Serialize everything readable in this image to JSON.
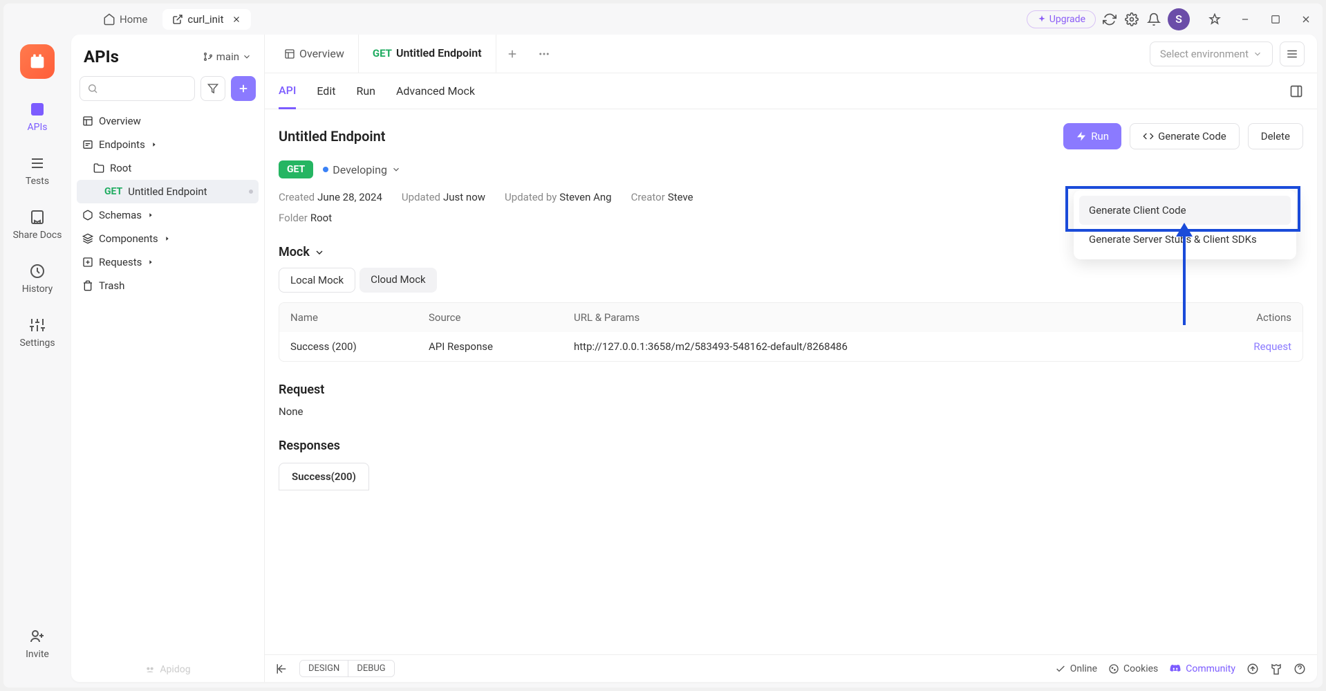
{
  "titlebar": {
    "home": "Home",
    "active_tab": "curl_init",
    "upgrade": "Upgrade",
    "avatar_letter": "S"
  },
  "rail": {
    "items": [
      "APIs",
      "Tests",
      "Share Docs",
      "History",
      "Settings",
      "Invite"
    ]
  },
  "sidebar": {
    "title": "APIs",
    "branch": "main",
    "tree": {
      "overview": "Overview",
      "endpoints": "Endpoints",
      "root": "Root",
      "endpoint_method": "GET",
      "endpoint_name": "Untitled Endpoint",
      "schemas": "Schemas",
      "components": "Components",
      "requests": "Requests",
      "trash": "Trash"
    },
    "footer": "Apidog"
  },
  "editor": {
    "tabs": {
      "overview": "Overview",
      "endpoint_method": "GET",
      "endpoint_name": "Untitled Endpoint"
    },
    "env_placeholder": "Select environment",
    "subtabs": [
      "API",
      "Edit",
      "Run",
      "Advanced Mock"
    ],
    "title": "Untitled Endpoint",
    "buttons": {
      "run": "Run",
      "generate": "Generate Code",
      "delete": "Delete"
    },
    "method": "GET",
    "status": "Developing",
    "meta": {
      "created_label": "Created",
      "created_val": "June 28, 2024",
      "updated_label": "Updated",
      "updated_val": "Just now",
      "updatedby_label": "Updated by",
      "updatedby_val": "Steven Ang",
      "creator_label": "Creator",
      "creator_val": "Steve",
      "folder_label": "Folder",
      "folder_val": "Root"
    },
    "mock": {
      "heading": "Mock",
      "local": "Local Mock",
      "cloud": "Cloud Mock",
      "cols": {
        "name": "Name",
        "source": "Source",
        "url": "URL & Params",
        "actions": "Actions"
      },
      "row": {
        "name": "Success (200)",
        "source": "API Response",
        "url": "http://127.0.0.1:3658/m2/583493-548162-default/8268486",
        "action": "Request"
      }
    },
    "request": {
      "heading": "Request",
      "body": "None"
    },
    "responses": {
      "heading": "Responses",
      "tab": "Success(200)"
    },
    "footer": {
      "design": "DESIGN",
      "debug": "DEBUG",
      "online": "Online",
      "cookies": "Cookies",
      "community": "Community"
    },
    "dropdown": {
      "client": "Generate Client Code",
      "server": "Generate Server Stubs & Client SDKs"
    }
  }
}
